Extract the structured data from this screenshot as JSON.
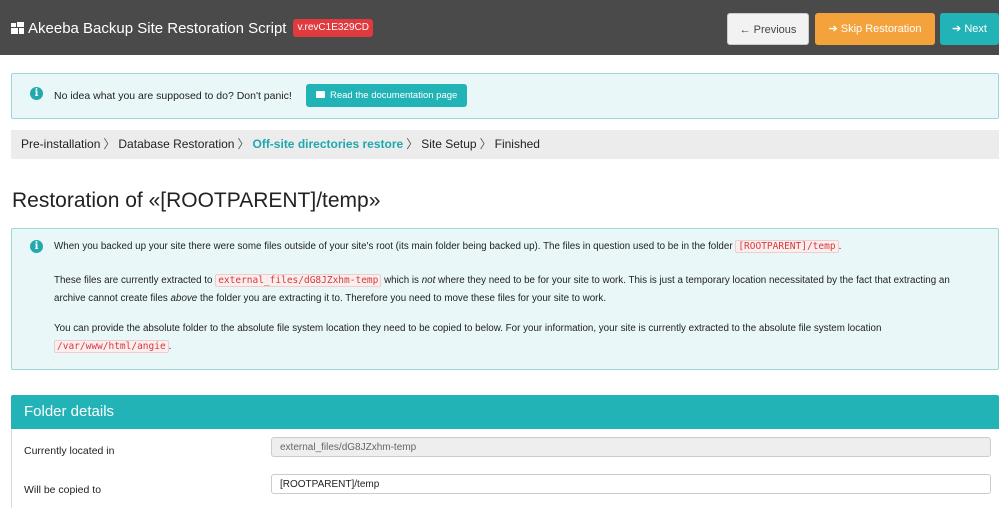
{
  "header": {
    "title": "Akeeba Backup Site Restoration Script",
    "version": "v.revC1E329CD",
    "prev_label": "← Previous",
    "skip_label": "➔ Skip Restoration",
    "next_label": "➔ Next"
  },
  "notice": {
    "text": "No idea what you are supposed to do? Don't panic!",
    "doc_button": "Read the documentation page"
  },
  "breadcrumb": {
    "items": [
      "Pre-installation",
      "Database Restoration",
      "Off-site directories restore",
      "Site Setup",
      "Finished"
    ],
    "separator": "〉"
  },
  "page_title": "Restoration of «[ROOTPARENT]/temp»",
  "explain": {
    "p1_text": "When you backed up your site there were some files outside of your site's root (its main folder being backed up). The files in question used to be in the folder",
    "p1_code": "[ROOTPARENT]/temp",
    "p1_end": ".",
    "p2_a": "These files are currently extracted to",
    "p2_code": "external_files/dG8JZxhm-temp",
    "p2_b": "which is",
    "p2_em": "not",
    "p2_c": "where they need to be for your site to work. This is just a temporary location necessitated by the fact that",
    "p2_d": "extracting an archive cannot create files",
    "p2_em2": "above",
    "p2_e": "the folder you are extracting it to. Therefore you need to move these files for your site to work.",
    "p3_a": "You can provide the absolute folder to the absolute file system location they need to be copied to below. For your information, your site is currently extracted to the absolute file system location",
    "p3_code": "/var/www/html/angie",
    "p3_end": "."
  },
  "folder_details": {
    "heading": "Folder details",
    "current_label": "Currently located in",
    "current_value": "external_files/dG8JZxhm-temp",
    "target_label": "Will be copied to",
    "target_value": "[ROOTPARENT]/temp"
  },
  "colors": {
    "header_bg": "#4a4a4a",
    "accent": "#22b3b7",
    "warning": "#f4a23b",
    "version_badge": "#e03a3e"
  }
}
